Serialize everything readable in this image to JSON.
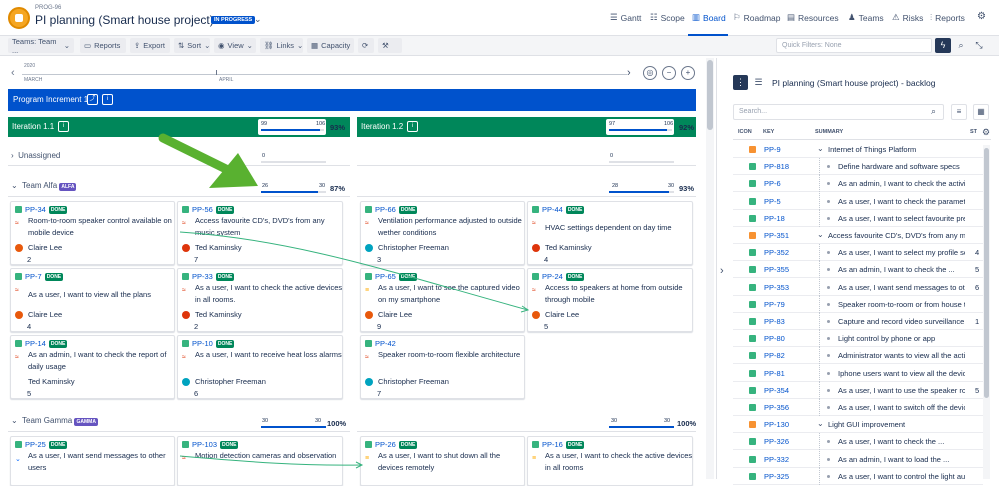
{
  "header": {
    "project_key": "PROG-96",
    "project_title": "PI planning (Smart house project)",
    "status_badge": "IN PROGRESS",
    "nav": [
      {
        "label": "Gantt",
        "icon": "gantt-icon"
      },
      {
        "label": "Scope",
        "icon": "scope-icon"
      },
      {
        "label": "Board",
        "icon": "board-icon",
        "active": true
      },
      {
        "label": "Roadmap",
        "icon": "roadmap-icon"
      },
      {
        "label": "Resources",
        "icon": "resources-icon"
      },
      {
        "label": "Teams",
        "icon": "teams-icon"
      },
      {
        "label": "Risks",
        "icon": "risks-icon"
      },
      {
        "label": "Reports",
        "icon": "reports-icon"
      }
    ]
  },
  "toolbar": {
    "teams": "Teams: Team ...",
    "reports": "Reports",
    "export": "Export",
    "sort": "Sort",
    "view": "View",
    "links": "Links",
    "capacity": "Capacity",
    "quick_filters_placeholder": "Quick Filters: None"
  },
  "timeline": {
    "year": "2020",
    "months": [
      "MARCH",
      "APRIL"
    ]
  },
  "program_increment": {
    "label": "Program Increment 1"
  },
  "iterations": [
    {
      "label": "Iteration 1.1",
      "done": "99",
      "total": "106",
      "pct": "93%",
      "fill": 0.93
    },
    {
      "label": "Iteration 1.2",
      "done": "97",
      "total": "106",
      "pct": "92%",
      "fill": 0.92
    }
  ],
  "unassigned": {
    "label": "Unassigned",
    "a": "0",
    "b": "0"
  },
  "team_alfa": {
    "label": "Team Alfa",
    "badge": "ALFA",
    "it1": {
      "done": "26",
      "total": "30",
      "pct": "87%",
      "fill": 0.87
    },
    "it2": {
      "done": "28",
      "total": "30",
      "pct": "93%",
      "fill": 0.93
    }
  },
  "team_gamma": {
    "label": "Team Gamma",
    "badge": "GAMMA",
    "it1": {
      "done": "30",
      "total": "30",
      "pct": "100%",
      "fill": 1.0
    },
    "it2": {
      "done": "30",
      "total": "30",
      "pct": "100%",
      "fill": 1.0
    }
  },
  "done_label": "DONE",
  "cards": {
    "c1": {
      "key": "PP-34",
      "title": "Room-to-room speaker control available on mobile device",
      "assignee": "Claire Lee",
      "sp": "2"
    },
    "c2": {
      "key": "PP-56",
      "title": "Access favourite CD's, DVD's from any music system",
      "assignee": "Ted Kaminsky",
      "sp": "7"
    },
    "c3": {
      "key": "PP-66",
      "title": "Ventilation performance adjusted to outside wether conditions",
      "assignee": "Christopher Freeman",
      "sp": "3"
    },
    "c4": {
      "key": "PP-44",
      "title": "HVAC settings dependent on day time",
      "assignee": "Ted Kaminsky",
      "sp": "4"
    },
    "c5": {
      "key": "PP-7",
      "title": "As a user, I want to view all the plans",
      "assignee": "Claire Lee",
      "sp": "4"
    },
    "c6": {
      "key": "PP-33",
      "title": "As a user, I want to check the active devices in all rooms.",
      "assignee": "Ted Kaminsky",
      "sp": "2"
    },
    "c7": {
      "key": "PP-65",
      "title": "As a user, I want to see the captured video on my smartphone",
      "assignee": "Claire Lee",
      "sp": "9"
    },
    "c8": {
      "key": "PP-24",
      "title": "Access to speakers at home from outside through mobile",
      "assignee": "Claire Lee",
      "sp": "5"
    },
    "c9": {
      "key": "PP-14",
      "title": "As an admin, I want to check the report of daily usage",
      "assignee": "Ted Kaminsky",
      "sp": "5"
    },
    "c10": {
      "key": "PP-10",
      "title": "As a user, I want to receive heat loss alarms",
      "assignee": "Christopher Freeman",
      "sp": "6"
    },
    "c11": {
      "key": "PP-42",
      "title": "Speaker room-to-room flexible architecture",
      "assignee": "Christopher Freeman",
      "sp": "7"
    },
    "c12": {
      "key": "PP-25",
      "title": "As a user, I want send messages to other users"
    },
    "c13": {
      "key": "PP-103",
      "title": "Motion detection cameras and observation"
    },
    "c14": {
      "key": "PP-26",
      "title": "As a user, I want to shut down all the devices remotely"
    },
    "c15": {
      "key": "PP-16",
      "title": "As a user, I want to check the active devices in all rooms"
    }
  },
  "backlog": {
    "title": "PI planning (Smart house project) - backlog",
    "search_placeholder": "Search...",
    "columns": {
      "icon": "ICON",
      "key": "KEY",
      "summary": "SUMMARY",
      "st": "ST"
    },
    "rows": [
      {
        "key": "PP-9",
        "summary": "Internet of Things Platform",
        "type": "epic",
        "sp": ""
      },
      {
        "key": "PP-818",
        "summary": "Define hardware and software specs",
        "type": "story",
        "sp": ""
      },
      {
        "key": "PP-6",
        "summary": "As an admin, I want to check the activit",
        "type": "story",
        "sp": ""
      },
      {
        "key": "PP-5",
        "summary": "As a user, I want to check the paramete",
        "type": "story",
        "sp": ""
      },
      {
        "key": "PP-18",
        "summary": "As a user, I want to select favourite pres",
        "type": "story",
        "sp": ""
      },
      {
        "key": "PP-351",
        "summary": "Access favourite CD's, DVD's from any mu",
        "type": "epic",
        "sp": ""
      },
      {
        "key": "PP-352",
        "summary": "As a user, I want to select my profile so",
        "type": "story",
        "sp": "4"
      },
      {
        "key": "PP-355",
        "summary": "As an admin, I want to check the ...",
        "type": "story",
        "sp": "5"
      },
      {
        "key": "PP-353",
        "summary": "As a user, I want send messages to oth",
        "type": "story",
        "sp": "6"
      },
      {
        "key": "PP-79",
        "summary": "Speaker room-to-room or from house to",
        "type": "story",
        "sp": ""
      },
      {
        "key": "PP-83",
        "summary": "Capture and record video surveillance",
        "type": "story",
        "sp": "1"
      },
      {
        "key": "PP-80",
        "summary": "Light control by phone or app",
        "type": "story",
        "sp": ""
      },
      {
        "key": "PP-82",
        "summary": "Administrator wants to view all the activ",
        "type": "story",
        "sp": ""
      },
      {
        "key": "PP-81",
        "summary": "Iphone users want to view all the device",
        "type": "story",
        "sp": ""
      },
      {
        "key": "PP-354",
        "summary": "As a user, I want to use the speaker roo",
        "type": "story",
        "sp": "5"
      },
      {
        "key": "PP-356",
        "summary": "As a user, I want to switch off the devic",
        "type": "story",
        "sp": ""
      },
      {
        "key": "PP-130",
        "summary": "Light GUI improvement",
        "type": "epic",
        "sp": ""
      },
      {
        "key": "PP-326",
        "summary": "As a user, I want to check the ...",
        "type": "story",
        "sp": ""
      },
      {
        "key": "PP-332",
        "summary": "As an admin, I want to load the ...",
        "type": "story",
        "sp": ""
      },
      {
        "key": "PP-325",
        "summary": "As a user, I want to control the light auto",
        "type": "story",
        "sp": ""
      }
    ]
  },
  "colors": {
    "brand": "#0052cc",
    "iteration": "#00875a",
    "done": "#00875a",
    "story": "#36b37e",
    "epic": "#f79232",
    "annotation_arrow": "#59b130",
    "team_badge": "#6554c0"
  }
}
